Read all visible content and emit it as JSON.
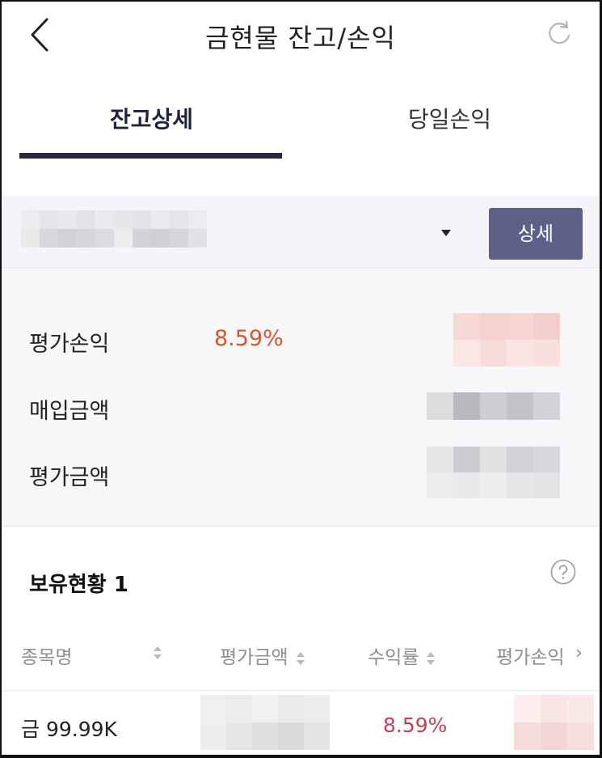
{
  "header": {
    "title": "금현물 잔고/손익",
    "back_icon": "chevron-left-icon",
    "refresh_icon": "refresh-icon"
  },
  "tabs": [
    {
      "label": "잔고상세",
      "active": true
    },
    {
      "label": "당일손익",
      "active": false
    }
  ],
  "account": {
    "detail_button": "상세",
    "dropdown_icon": "caret-down-icon"
  },
  "summary": {
    "profit_loss_label": "평가손익",
    "profit_loss_rate": "8.59%",
    "purchase_amount_label": "매입금액",
    "evaluation_amount_label": "평가금액"
  },
  "holdings": {
    "title": "보유현황 1",
    "help_icon": "question-circle-icon",
    "columns": [
      "종목명",
      "평가금액",
      "수익률",
      "평가손익"
    ],
    "rows": [
      {
        "name": "금 99.99K",
        "return_rate": "8.59%"
      }
    ]
  },
  "colors": {
    "accent_navy": "#26283f",
    "button": "#5d6088",
    "profit_red": "#d8552e",
    "row_rate_red": "#c64055"
  }
}
